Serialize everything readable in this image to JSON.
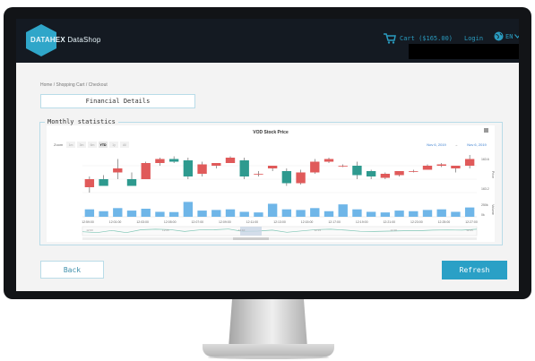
{
  "header": {
    "logo_bold": "DATAHEX",
    "logo_thin": "DataShop",
    "cart_text": "Cart ($165.00)",
    "login_label": "Login",
    "lang_code": "EN",
    "icons": [
      "cart-icon",
      "globe-icon",
      "chevron-down-icon"
    ]
  },
  "breadcrumb": "Home / Shopping Cart / Checkout",
  "section_title": "Financial Details",
  "stats_label": "Monthly statistics",
  "buttons": {
    "back": "Back",
    "refresh": "Refresh"
  },
  "chart_data": {
    "type": "candlestick",
    "title": "VOD Stock Price",
    "range_selector": {
      "label": "Zoom",
      "options": [
        "1m",
        "3m",
        "6m",
        "YTD",
        "1y",
        "All"
      ]
    },
    "date_range": {
      "from": "Nov 6, 2019",
      "separator": "→",
      "to": "Nov 6, 2019"
    },
    "y_axis_labels": [
      "163.6",
      "163.2"
    ],
    "y_axis_title": "Price",
    "volume_axis_labels": [
      "250k",
      "0k"
    ],
    "volume_axis_title": "Volume",
    "x_labels": [
      "12:59:00",
      "12:01:00",
      "12:03:00",
      "12:05:00",
      "12:07:00",
      "12:09:00",
      "12:11:00",
      "12:13:00",
      "12:15:00",
      "12:17:00",
      "12:19:00",
      "12:21:00",
      "12:23:00",
      "12:25:00",
      "12:27:00"
    ],
    "navigator_labels": [
      "12:00",
      "12:05",
      "12:10",
      "12:15",
      "12:20",
      "12:25"
    ],
    "candles": [
      {
        "o": 163.34,
        "h": 163.42,
        "l": 163.3,
        "c": 163.4
      },
      {
        "o": 163.4,
        "h": 163.43,
        "l": 163.38,
        "c": 163.35
      },
      {
        "o": 163.45,
        "h": 163.55,
        "l": 163.4,
        "c": 163.48
      },
      {
        "o": 163.4,
        "h": 163.45,
        "l": 163.36,
        "c": 163.35
      },
      {
        "o": 163.4,
        "h": 163.53,
        "l": 163.4,
        "c": 163.52
      },
      {
        "o": 163.52,
        "h": 163.56,
        "l": 163.5,
        "c": 163.55
      },
      {
        "o": 163.55,
        "h": 163.57,
        "l": 163.52,
        "c": 163.53
      },
      {
        "o": 163.54,
        "h": 163.56,
        "l": 163.4,
        "c": 163.42
      },
      {
        "o": 163.44,
        "h": 163.53,
        "l": 163.42,
        "c": 163.51
      },
      {
        "o": 163.5,
        "h": 163.52,
        "l": 163.48,
        "c": 163.52
      },
      {
        "o": 163.52,
        "h": 163.57,
        "l": 163.52,
        "c": 163.56
      },
      {
        "o": 163.54,
        "h": 163.56,
        "l": 163.4,
        "c": 163.42
      },
      {
        "o": 163.44,
        "h": 163.46,
        "l": 163.42,
        "c": 163.44
      },
      {
        "o": 163.48,
        "h": 163.5,
        "l": 163.46,
        "c": 163.5
      },
      {
        "o": 163.46,
        "h": 163.48,
        "l": 163.35,
        "c": 163.37
      },
      {
        "o": 163.37,
        "h": 163.47,
        "l": 163.36,
        "c": 163.45
      },
      {
        "o": 163.45,
        "h": 163.55,
        "l": 163.44,
        "c": 163.53
      },
      {
        "o": 163.53,
        "h": 163.56,
        "l": 163.52,
        "c": 163.55
      },
      {
        "o": 163.5,
        "h": 163.51,
        "l": 163.49,
        "c": 163.5
      },
      {
        "o": 163.5,
        "h": 163.53,
        "l": 163.4,
        "c": 163.43
      },
      {
        "o": 163.46,
        "h": 163.47,
        "l": 163.4,
        "c": 163.42
      },
      {
        "o": 163.41,
        "h": 163.45,
        "l": 163.4,
        "c": 163.44
      },
      {
        "o": 163.43,
        "h": 163.46,
        "l": 163.42,
        "c": 163.46
      },
      {
        "o": 163.46,
        "h": 163.47,
        "l": 163.45,
        "c": 163.46
      },
      {
        "o": 163.47,
        "h": 163.51,
        "l": 163.47,
        "c": 163.5
      },
      {
        "o": 163.5,
        "h": 163.52,
        "l": 163.49,
        "c": 163.51
      },
      {
        "o": 163.48,
        "h": 163.5,
        "l": 163.45,
        "c": 163.5
      },
      {
        "o": 163.5,
        "h": 163.58,
        "l": 163.48,
        "c": 163.55
      }
    ],
    "volumes": [
      60,
      45,
      70,
      50,
      65,
      40,
      38,
      120,
      50,
      55,
      60,
      40,
      35,
      105,
      60,
      55,
      70,
      45,
      100,
      60,
      40,
      35,
      50,
      45,
      55,
      60,
      40,
      75
    ],
    "colors": {
      "up": "#e05a5a",
      "down": "#2e9a8f",
      "volume": "#6fb6e8",
      "navigator_line": "#7fc6b5",
      "date_range": "#3a7fd0"
    }
  }
}
